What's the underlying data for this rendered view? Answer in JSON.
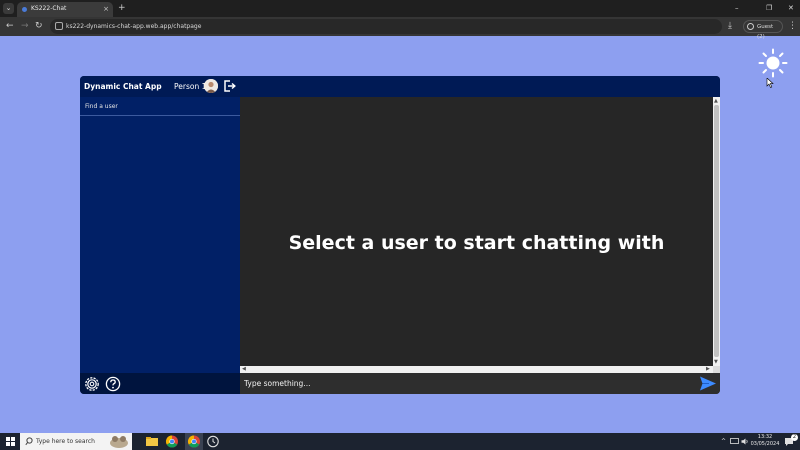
{
  "browser": {
    "tab_title": "KS222-Chat",
    "tab_close": "×",
    "new_tab": "+",
    "url": "ks222-dynamics-chat-app.web.app/chatpage",
    "profile_label": "Guest (2)",
    "menu_glyph": "⋮",
    "download_glyph": "⤓",
    "back_glyph": "←",
    "forward_glyph": "→",
    "reload_glyph": "↻",
    "minimize_glyph": "–",
    "restore_glyph": "❐",
    "close_glyph": "✕",
    "tab_list_glyph": "⌄"
  },
  "app": {
    "title": "Dynamic Chat App",
    "person_name": "Person 1",
    "find_user_label": "Find a user",
    "empty_message": "Select a user to start chatting with",
    "compose_placeholder": "Type something...",
    "icons": {
      "avatar": "avatar-icon",
      "logout": "logout-icon",
      "settings": "gear-icon",
      "help": "question-icon",
      "send": "send-icon",
      "theme": "sun-icon"
    }
  },
  "taskbar": {
    "search_placeholder": "Type here to search",
    "time": "13:32",
    "date": "03/05/2024",
    "tray_up": "^",
    "notification_count": "2"
  },
  "colors": {
    "page_background": "#8d9ff0",
    "sidebar": "#012066",
    "header": "#001a55",
    "chat_background": "#262626",
    "send_accent": "#3d8bff"
  }
}
